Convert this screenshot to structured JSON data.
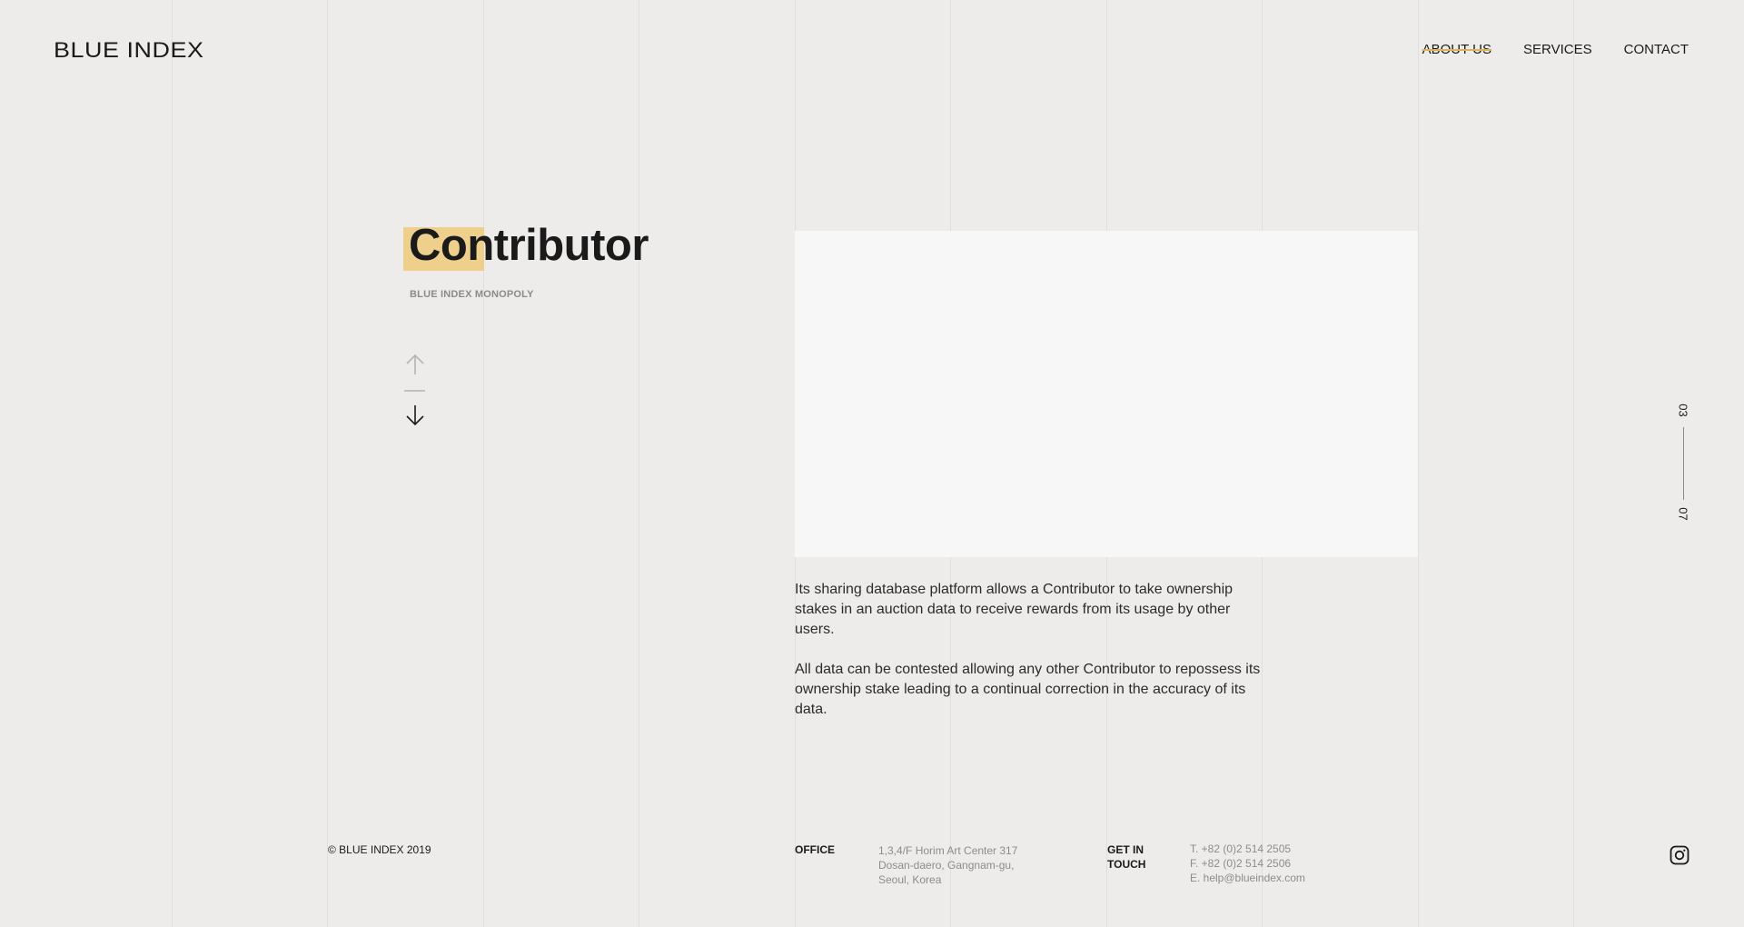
{
  "header": {
    "logo": "BLUE INDEX",
    "nav": [
      {
        "label": "ABOUT US",
        "active": true
      },
      {
        "label": "SERVICES",
        "active": false
      },
      {
        "label": "CONTACT",
        "active": false
      }
    ]
  },
  "hero": {
    "title": "Contributor",
    "subtitle": "BLUE INDEX MONOPOLY",
    "arrows": {
      "up": "arrow-up-icon",
      "down": "arrow-down-icon"
    }
  },
  "content": {
    "paragraphs": [
      "Its sharing database platform allows a Contributor to take ownership stakes in an auction data to receive rewards from its usage by other users.",
      "All data can be contested allowing any other Contributor to repossess its ownership stake leading to a continual correction in the accuracy of its data."
    ]
  },
  "pager": {
    "current": "03",
    "total": "07"
  },
  "footer": {
    "copyright": "© BLUE INDEX 2019",
    "office_label": "OFFICE",
    "office_lines": [
      "1,3,4/F Horim Art Center 317",
      "Dosan-daero, Gangnam-gu,",
      "Seoul, Korea"
    ],
    "contact_label_line1": "GET IN",
    "contact_label_line2": "TOUCH",
    "contact_lines": [
      "T. +82 (0)2 514 2505",
      "F. +82 (0)2 514 2506",
      "E. help@blueindex.com"
    ],
    "social_icon": "instagram-icon"
  },
  "colors": {
    "background": "#edecea",
    "accent": "#eecf8c",
    "panel": "#f7f7f7",
    "text": "#1a1a1a",
    "muted": "#8c8c8c"
  }
}
